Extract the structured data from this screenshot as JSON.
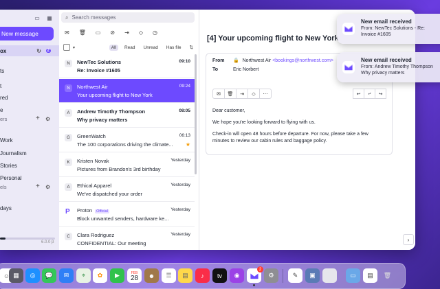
{
  "sidebar": {
    "new_message_label": "New message",
    "items": [
      {
        "label": "ox",
        "active": true,
        "count": "2"
      },
      {
        "label": "ts"
      },
      {
        "label": "t"
      },
      {
        "label": "red"
      },
      {
        "label": "e"
      }
    ],
    "folders_section_label": "ers",
    "folders": [
      {
        "label": "Work"
      },
      {
        "label": "Journalism"
      },
      {
        "label": "Stories"
      },
      {
        "label": "Personal"
      }
    ],
    "labels_section_label": "els",
    "labels": [
      {
        "label": "days"
      }
    ],
    "version": "6.0.0 β"
  },
  "list": {
    "search_placeholder": "Search messages",
    "filters": {
      "all": "All",
      "read": "Read",
      "unread": "Unread",
      "has_file": "Has file"
    },
    "rows": [
      {
        "initial": "N",
        "sender": "NewTec Solutions",
        "subject": "Re: Invoice #1605",
        "time": "09:10",
        "unread": true
      },
      {
        "initial": "N",
        "sender": "Northwest Air",
        "subject": "Your upcoming flight to New York",
        "time": "09:24",
        "selected": true
      },
      {
        "initial": "A",
        "sender": "Andrew Timothy Thompson",
        "subject": "Why privacy matters",
        "time": "08:05",
        "unread": true
      },
      {
        "initial": "G",
        "sender": "GreenWatch",
        "subject": "The 100 corporations driving the climate...",
        "time": "06:13",
        "starred": true
      },
      {
        "initial": "K",
        "sender": "Kristen Novak",
        "subject": "Pictures from Brandon's 3rd birthday",
        "time": "Yesterday"
      },
      {
        "initial": "A",
        "sender": "Ethical Apparel",
        "subject": "We've dispatched your order",
        "time": "Yesterday"
      },
      {
        "initial": "P",
        "sender": "Proton",
        "badge": "Official",
        "subject": "Block unwanted senders, hardware ke...",
        "time": "Yesterday"
      },
      {
        "initial": "C",
        "sender": "Clara Rodriguez",
        "subject": "CONFIDENTIAL: Our meeting",
        "time": "Yesterday"
      }
    ]
  },
  "reader": {
    "title": "[4] Your upcoming flight to New York",
    "from_label": "From",
    "from_name": "Northwest Air",
    "from_address": "<bookings@northwest.com>",
    "to_label": "To",
    "to_name": "Eric Norbert",
    "body": [
      "Dear customer,",
      "We hope you're looking forward to flying with us.",
      "Check-in will open 48 hours before departure. For now, please take a few minutes to review our cabin rules and baggage policy."
    ]
  },
  "notifications": [
    {
      "title": "New email received",
      "body": "From: NewTec Solutions - Re: Invoice #1605"
    },
    {
      "title": "New email received",
      "body": "From: Andrew Timothy Thompson Why privacy matters"
    }
  ],
  "dock": {
    "calendar_day": "28",
    "calendar_month": "FEB",
    "mail_badge": "2"
  },
  "colors": {
    "accent": "#6d4aff",
    "star": "#f59e0b",
    "badge_red": "#ff3b30"
  }
}
